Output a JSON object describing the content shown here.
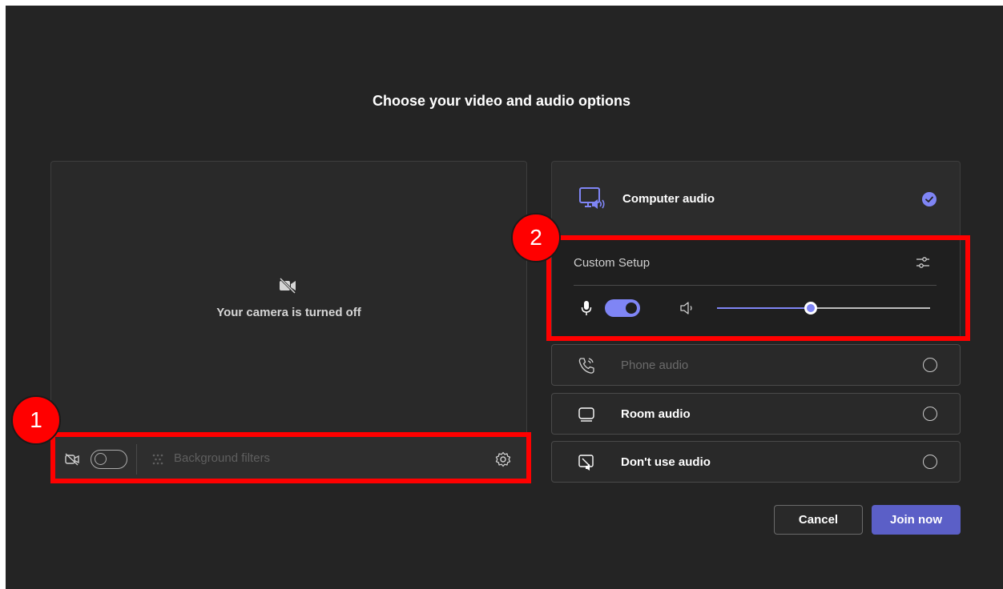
{
  "dialog": {
    "title": "Choose your video and audio options"
  },
  "video_preview": {
    "status_text": "Your camera is turned off",
    "camera_toggle_on": false,
    "background_filters_label": "Background filters",
    "icons": [
      "video-off-icon",
      "camera-icon",
      "background-filters-icon",
      "gear-icon"
    ]
  },
  "audio": {
    "computer_audio": {
      "label": "Computer audio",
      "selected": true,
      "icon": "computer-speaker-icon"
    },
    "custom_setup": {
      "label": "Custom Setup",
      "mic_on": true,
      "volume_fraction": 0.44,
      "icons": [
        "sliders-icon",
        "microphone-icon",
        "speaker-icon"
      ]
    },
    "options": [
      {
        "label": "Phone audio",
        "icon": "phone-icon",
        "selected": false,
        "disabled": true
      },
      {
        "label": "Room audio",
        "icon": "room-display-icon",
        "selected": false,
        "disabled": false
      },
      {
        "label": "Don't use audio",
        "icon": "no-audio-icon",
        "selected": false,
        "disabled": false
      }
    ]
  },
  "buttons": {
    "cancel": "Cancel",
    "join": "Join now"
  },
  "annotations": {
    "badge_1": "1",
    "badge_2": "2"
  },
  "colors": {
    "background": "#242424",
    "accent": "#7f85f5",
    "join_button": "#5b5fc7",
    "highlight": "#ff0000"
  }
}
